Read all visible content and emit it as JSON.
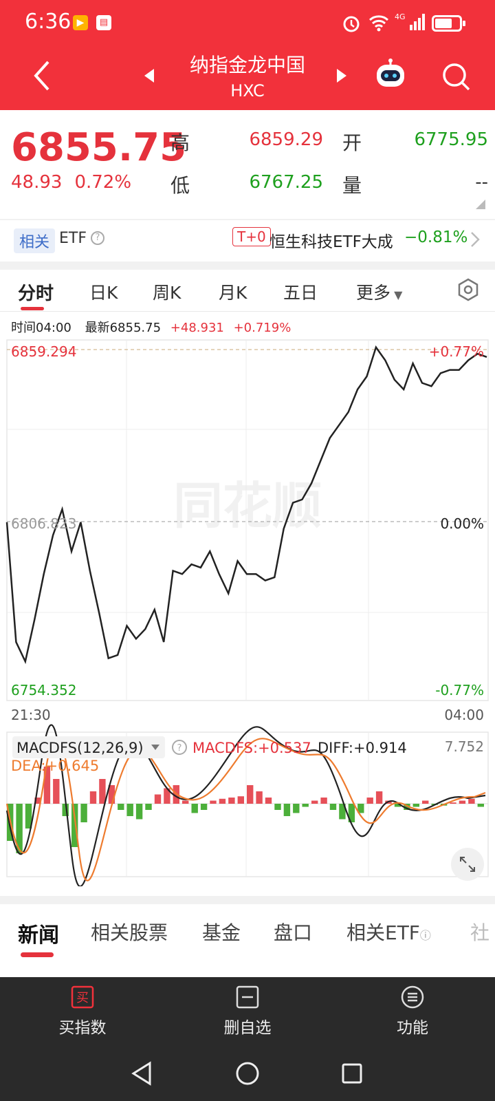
{
  "status": {
    "time": "6:36",
    "net": "4G"
  },
  "nav": {
    "title": "纳指金龙中国",
    "code": "HXC"
  },
  "quote": {
    "price": "6855.75",
    "change": "48.93",
    "change_pct": "0.72%",
    "high_label": "高",
    "high": "6859.29",
    "open_label": "开",
    "open": "6775.95",
    "low_label": "低",
    "low": "6767.25",
    "vol_label": "量",
    "vol": "--"
  },
  "etf": {
    "tag": "相关",
    "label": "ETF",
    "t0": "T+0",
    "name": "恒生科技ETF大成",
    "pct": "−0.81%"
  },
  "chart_tabs": [
    "分时",
    "日K",
    "周K",
    "月K",
    "五日",
    "更多"
  ],
  "info": {
    "time": "时间04:00",
    "latest": "最新6855.75",
    "chg": "+48.931",
    "pct": "+0.719%"
  },
  "chart_data": {
    "type": "line",
    "y_labels": {
      "high": "6859.294",
      "mid": "6806.823",
      "low": "6754.352"
    },
    "pct_labels": {
      "high": "+0.77%",
      "mid": "0.00%",
      "low": "-0.77%"
    },
    "x_labels": [
      "21:30",
      "04:00"
    ],
    "ylim": [
      6754.352,
      6859.294
    ],
    "price_line": [
      [
        0,
        6806
      ],
      [
        1,
        6769
      ],
      [
        2,
        6763
      ],
      [
        3,
        6776
      ],
      [
        4,
        6790
      ],
      [
        5,
        6802
      ],
      [
        6,
        6810
      ],
      [
        7,
        6797
      ],
      [
        8,
        6806
      ],
      [
        9,
        6791
      ],
      [
        10,
        6778
      ],
      [
        11,
        6764
      ],
      [
        12,
        6765
      ],
      [
        13,
        6774
      ],
      [
        14,
        6770
      ],
      [
        15,
        6773
      ],
      [
        16,
        6779
      ],
      [
        17,
        6769
      ],
      [
        18,
        6791
      ],
      [
        19,
        6790
      ],
      [
        20,
        6793
      ],
      [
        21,
        6792
      ],
      [
        22,
        6797
      ],
      [
        23,
        6790
      ],
      [
        24,
        6784
      ],
      [
        25,
        6794
      ],
      [
        26,
        6790
      ],
      [
        27,
        6790
      ],
      [
        28,
        6788
      ],
      [
        29,
        6789
      ],
      [
        30,
        6804
      ],
      [
        31,
        6812
      ],
      [
        32,
        6813
      ],
      [
        33,
        6818
      ],
      [
        34,
        6825
      ],
      [
        35,
        6832
      ],
      [
        36,
        6836
      ],
      [
        37,
        6840
      ],
      [
        38,
        6847
      ],
      [
        39,
        6851
      ],
      [
        40,
        6860
      ],
      [
        41,
        6856
      ],
      [
        42,
        6850
      ],
      [
        43,
        6847
      ],
      [
        44,
        6855
      ],
      [
        45,
        6849
      ],
      [
        46,
        6848
      ],
      [
        47,
        6852
      ],
      [
        48,
        6853
      ],
      [
        49,
        6853
      ],
      [
        50,
        6856
      ],
      [
        51,
        6858
      ],
      [
        52,
        6857
      ]
    ],
    "macd": {
      "label": "MACDFS(12,26,9)",
      "macdfs": "MACDFS:+0.537",
      "diff": "DIFF:+0.914",
      "dea": "DEA:+0.645",
      "max": "7.752"
    }
  },
  "news_tabs": [
    "新闻",
    "相关股票",
    "基金",
    "盘口",
    "相关ETF",
    "社"
  ],
  "actions": [
    "买指数",
    "删自选",
    "功能"
  ],
  "watermark": "同花顺"
}
